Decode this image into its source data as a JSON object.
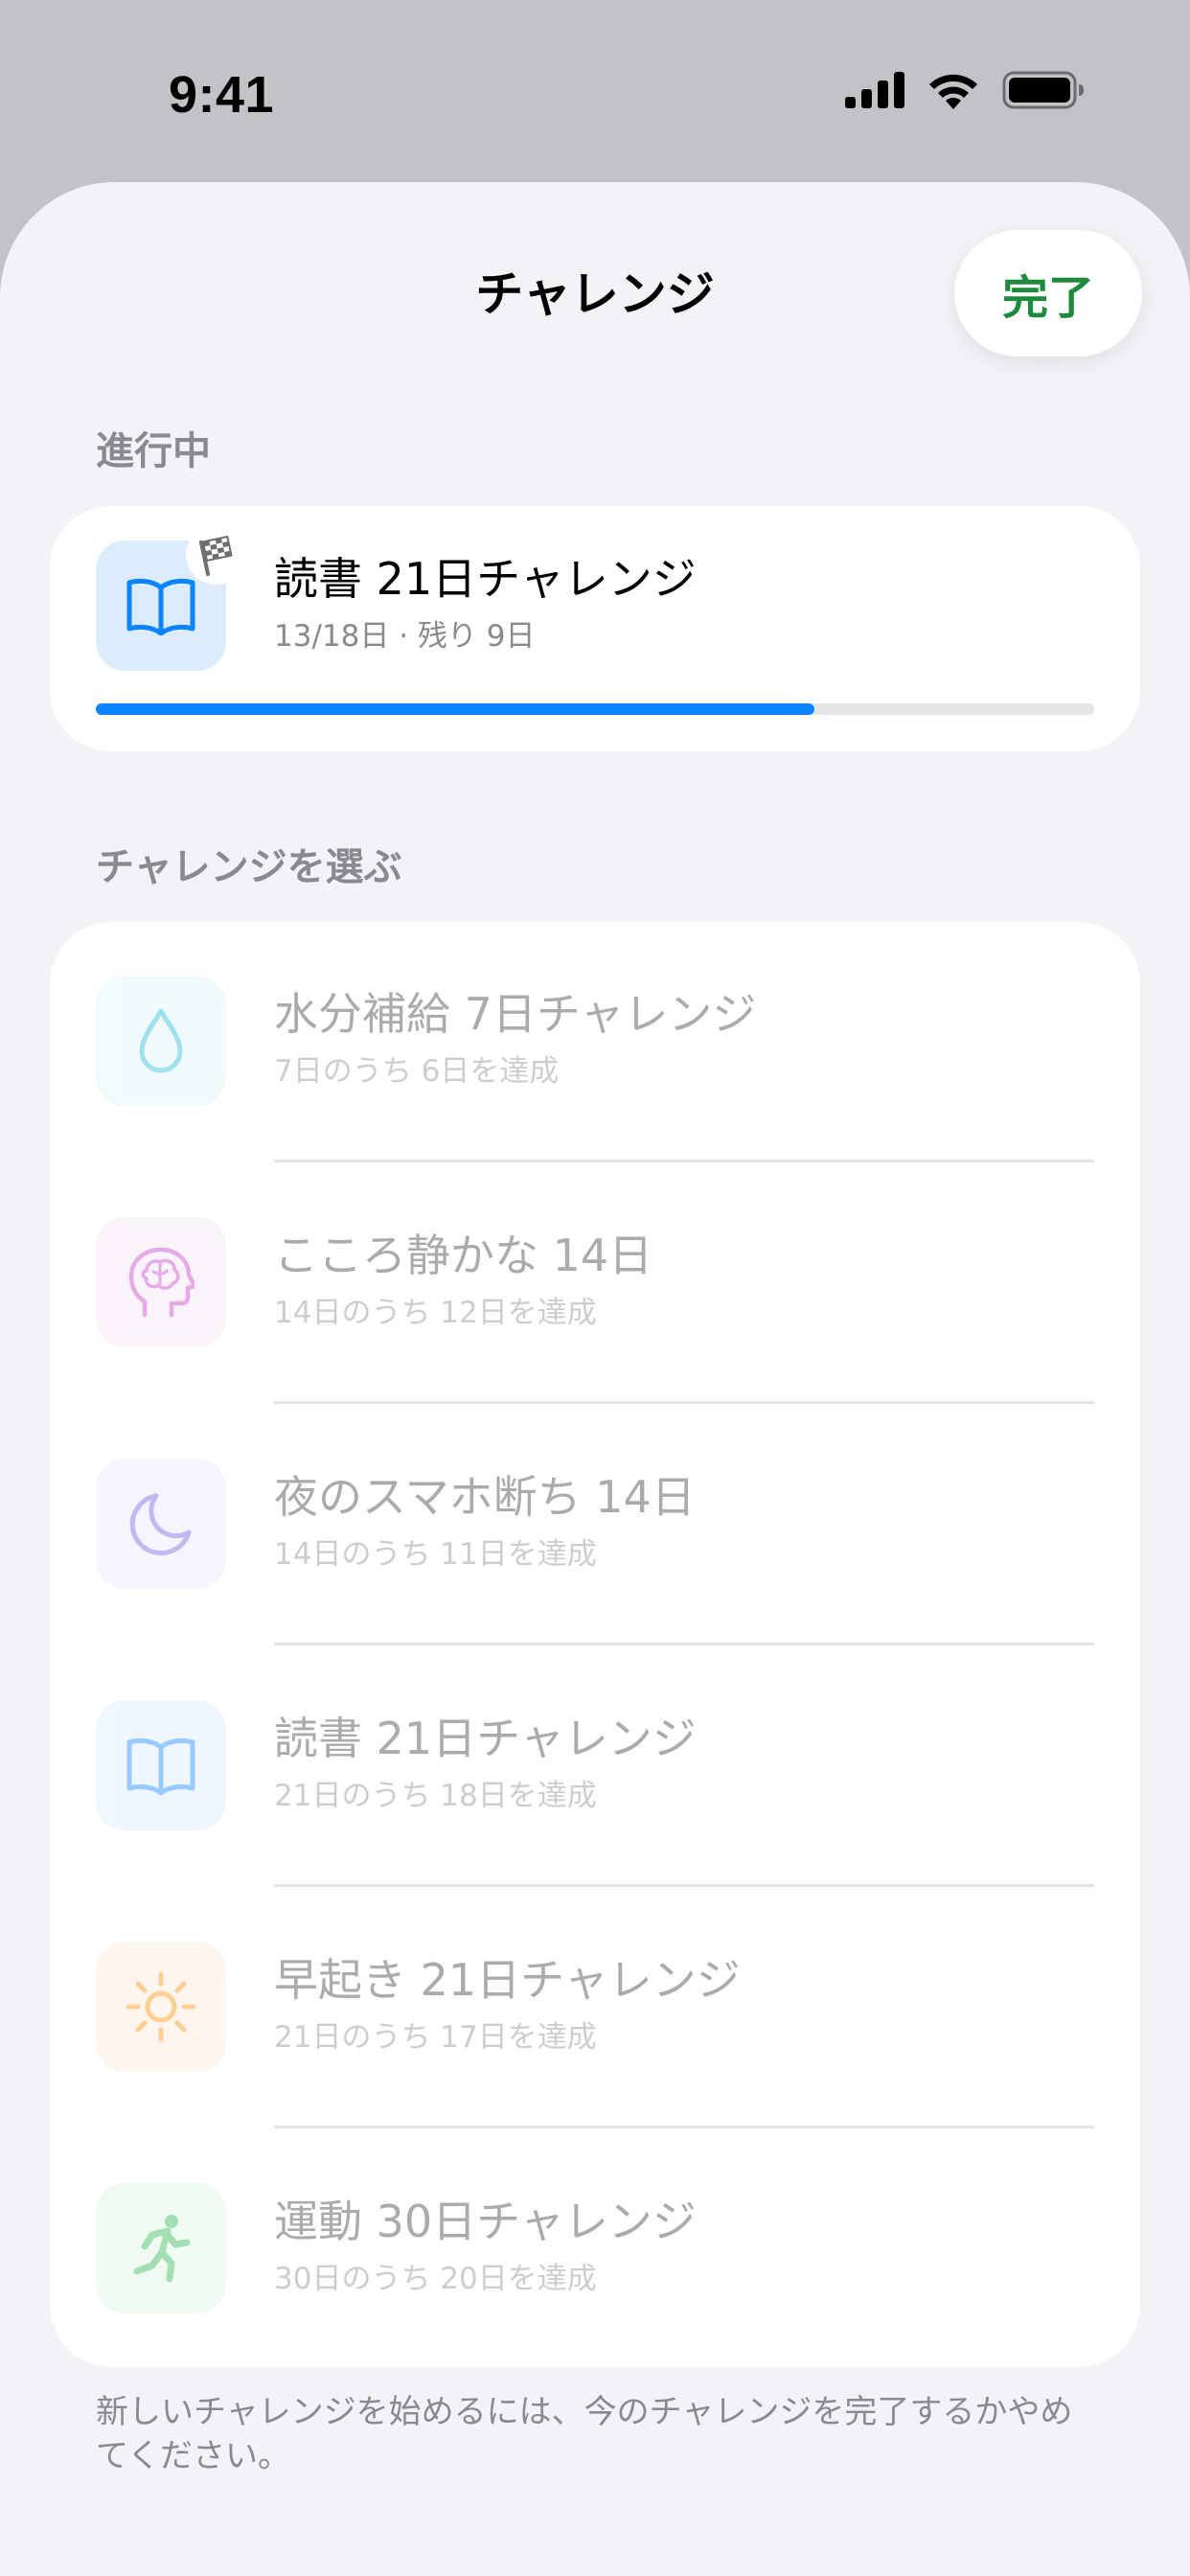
{
  "status_bar": {
    "time": "9:41",
    "icons": [
      "cellular-signal-icon",
      "wifi-icon",
      "battery-icon"
    ]
  },
  "header": {
    "title": "チャレンジ",
    "done_label": "完了",
    "done_color": "#1f8a3b"
  },
  "in_progress": {
    "section_label": "進行中",
    "challenge": {
      "title": "読書 21日チャレンジ",
      "subtitle": "13/18日 · 残り 9日",
      "icon": "book-icon",
      "badge_icon": "checkered-flag-icon",
      "progress": 0.72,
      "progress_color": "#0a84ff"
    }
  },
  "choose": {
    "section_label": "チャレンジを選ぶ",
    "items": [
      {
        "title": "水分補給 7日チャレンジ",
        "subtitle": "7日のうち 6日を達成",
        "icon": "water-drop-icon",
        "color": "#5ac8fa"
      },
      {
        "title": "こころ静かな 14日",
        "subtitle": "14日のうち 12日を達成",
        "icon": "brain-head-icon",
        "color": "#d35fd6"
      },
      {
        "title": "夜のスマホ断ち 14日",
        "subtitle": "14日のうち 11日を達成",
        "icon": "moon-icon",
        "color": "#7d6ee6"
      },
      {
        "title": "読書 21日チャレンジ",
        "subtitle": "21日のうち 18日を達成",
        "icon": "book-icon",
        "color": "#0a84ff"
      },
      {
        "title": "早起き 21日チャレンジ",
        "subtitle": "21日のうち 17日を達成",
        "icon": "sun-icon",
        "color": "#ff9500"
      },
      {
        "title": "運動 30日チャレンジ",
        "subtitle": "30日のうち 20日を達成",
        "icon": "running-figure-icon",
        "color": "#34c759"
      }
    ]
  },
  "footer": {
    "note": "新しいチャレンジを始めるには、今のチャレンジを完了するかやめてください。"
  }
}
